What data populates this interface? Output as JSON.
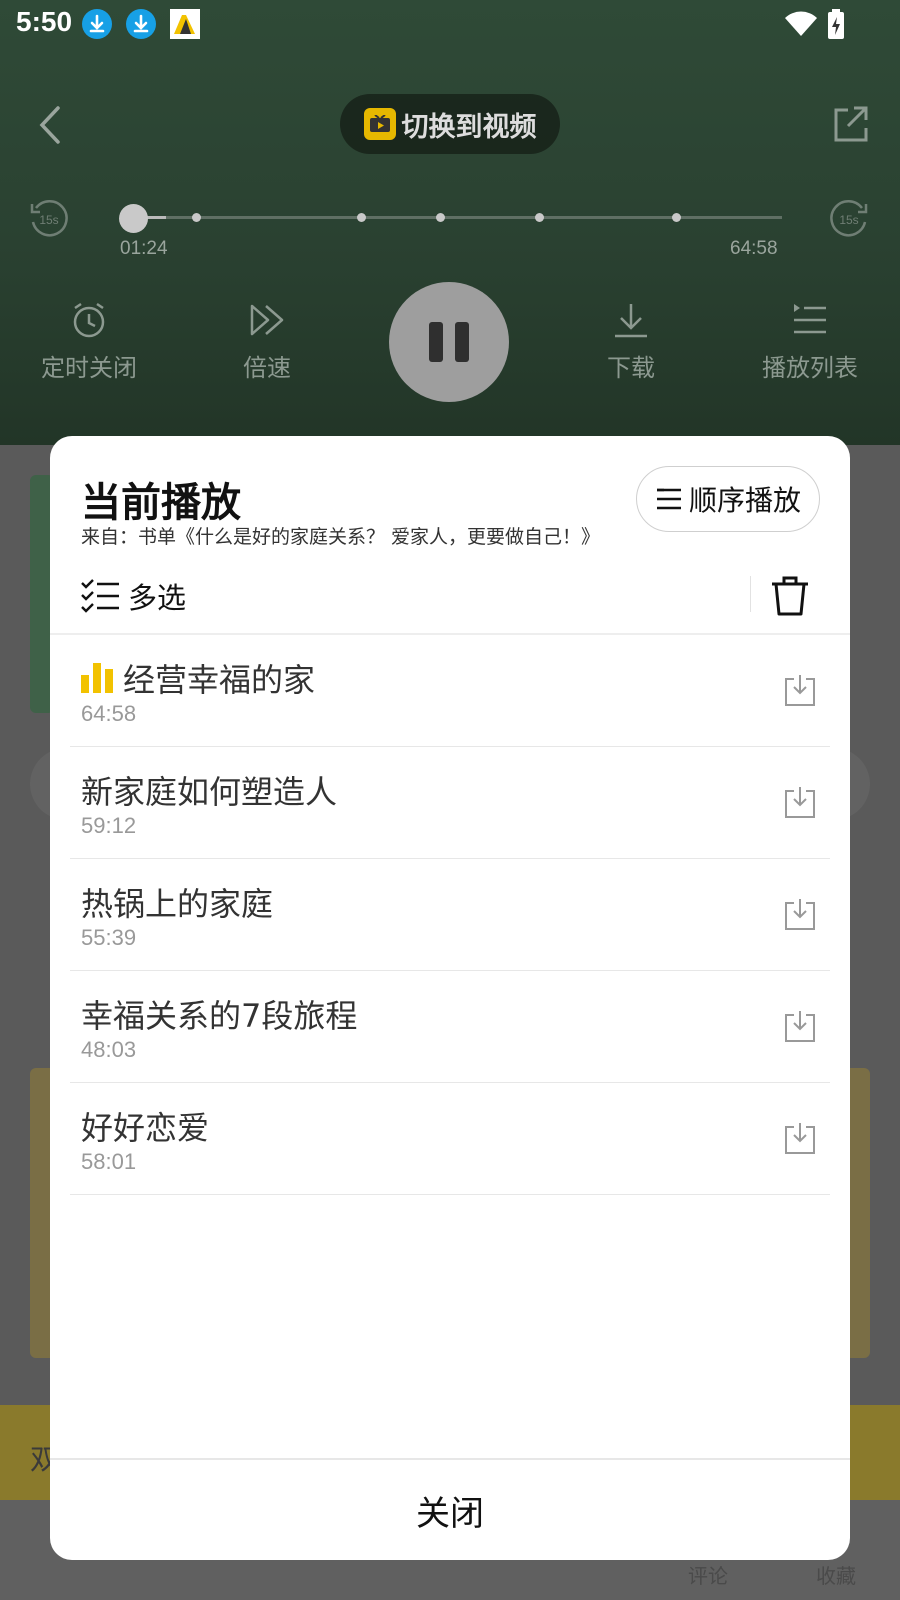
{
  "status_bar": {
    "time": "5:50"
  },
  "header": {
    "switch_video_label": "切换到视频"
  },
  "progress": {
    "current": "01:24",
    "total": "64:58",
    "rewind_label": "15s",
    "forward_label": "15s",
    "fraction": 0.022
  },
  "controls": {
    "timer_label": "定时关闭",
    "speed_label": "倍速",
    "download_label": "下载",
    "playlist_label": "播放列表"
  },
  "background_fragments": {
    "yellow_bar_char": "双",
    "comment_label": "评论",
    "favorite_label": "收藏"
  },
  "sheet": {
    "title": "当前播放",
    "source": "来自：书单《什么是好的家庭关系？ 爱家人，更要做自己！》",
    "order_label": "顺序播放",
    "multi_select_label": "多选",
    "close_label": "关闭",
    "items": [
      {
        "title": "经营幸福的家",
        "duration": "64:58",
        "playing": true
      },
      {
        "title": "新家庭如何塑造人",
        "duration": "59:12",
        "playing": false
      },
      {
        "title": "热锅上的家庭",
        "duration": "55:39",
        "playing": false
      },
      {
        "title": "幸福关系的7段旅程",
        "duration": "48:03",
        "playing": false
      },
      {
        "title": "好好恋爱",
        "duration": "58:01",
        "playing": false
      }
    ]
  },
  "colors": {
    "accent_playing": "#f2c200",
    "player_bg": "#2f4a37"
  }
}
